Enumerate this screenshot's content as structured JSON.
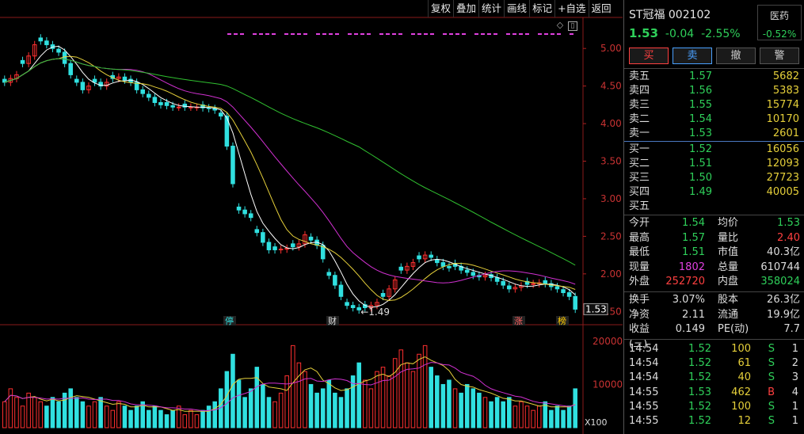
{
  "toolbar": [
    "复权",
    "叠加",
    "统计",
    "画线",
    "标记",
    "+自选",
    "返回"
  ],
  "chart": {
    "y_ticks": [
      "5.00",
      "4.50",
      "4.00",
      "3.50",
      "3.00",
      "2.50",
      "2.00",
      "1.50"
    ],
    "current_price": "1.53",
    "low_label": "1.49",
    "markers": [
      "停",
      "财",
      "涨",
      "榜"
    ],
    "vol_ticks": [
      "20000",
      "10000"
    ],
    "vol_unit": "X100"
  },
  "chart_data": {
    "type": "candlestick",
    "ylim": [
      1.45,
      5.35
    ],
    "closes": [
      4.55,
      4.6,
      4.65,
      4.8,
      4.9,
      5.05,
      5.1,
      5.05,
      5.0,
      4.95,
      4.8,
      4.65,
      4.55,
      4.45,
      4.5,
      4.55,
      4.5,
      4.55,
      4.6,
      4.62,
      4.58,
      4.55,
      4.45,
      4.4,
      4.35,
      4.28,
      4.25,
      4.24,
      4.22,
      4.22,
      4.22,
      4.22,
      4.22,
      4.21,
      4.2,
      4.18,
      4.1,
      3.7,
      3.2,
      2.85,
      2.8,
      2.75,
      2.55,
      2.42,
      2.32,
      2.32,
      2.33,
      2.34,
      2.36,
      2.4,
      2.52,
      2.45,
      2.38,
      2.2,
      1.98,
      1.85,
      1.7,
      1.58,
      1.55,
      1.52,
      1.55,
      1.58,
      1.62,
      1.7,
      1.8,
      1.92,
      2.05,
      2.1,
      2.15,
      2.2,
      2.25,
      2.22,
      2.15,
      2.1,
      2.08,
      2.1,
      2.05,
      2.02,
      1.98,
      1.96,
      1.98,
      1.95,
      1.9,
      1.85,
      1.8,
      1.82,
      1.84,
      1.86,
      1.87,
      1.88,
      1.87,
      1.83,
      1.8,
      1.75,
      1.7,
      1.53
    ],
    "volumes": [
      6000,
      9000,
      7000,
      5000,
      8000,
      7000,
      6000,
      5000,
      7000,
      6000,
      8000,
      9000,
      7000,
      6000,
      5000,
      6000,
      7000,
      5000,
      4000,
      6000,
      5000,
      4000,
      5000,
      6000,
      4000,
      5000,
      4000,
      3000,
      4000,
      5000,
      3000,
      4000,
      3000,
      4000,
      5000,
      6000,
      9000,
      13000,
      17000,
      11000,
      7000,
      9000,
      14000,
      10000,
      7000,
      6000,
      8000,
      12000,
      19000,
      15000,
      13000,
      10000,
      8000,
      9000,
      11000,
      8000,
      7000,
      9000,
      12000,
      15000,
      11000,
      9000,
      13000,
      14000,
      12000,
      16000,
      18000,
      15000,
      13000,
      17000,
      19000,
      14000,
      12000,
      10000,
      11000,
      9000,
      8000,
      10000,
      9000,
      8000,
      7000,
      6000,
      7000,
      6000,
      7000,
      5000,
      6000,
      5000,
      4000,
      5000,
      6000,
      4000,
      5000,
      4000,
      5000,
      9000
    ]
  },
  "quote": {
    "name": "ST冠福 002102",
    "price": "1.53",
    "change": "-0.04",
    "pct": "-2.55%",
    "industry": "医药",
    "industry_pct": "-0.52%"
  },
  "buttons": [
    "买",
    "卖",
    "撤",
    "警"
  ],
  "asks": [
    {
      "l": "卖五",
      "p": "1.57",
      "v": "5682"
    },
    {
      "l": "卖四",
      "p": "1.56",
      "v": "5383"
    },
    {
      "l": "卖三",
      "p": "1.55",
      "v": "15774"
    },
    {
      "l": "卖二",
      "p": "1.54",
      "v": "10170"
    },
    {
      "l": "卖一",
      "p": "1.53",
      "v": "2601"
    }
  ],
  "bids": [
    {
      "l": "买一",
      "p": "1.52",
      "v": "16056"
    },
    {
      "l": "买二",
      "p": "1.51",
      "v": "12093"
    },
    {
      "l": "买三",
      "p": "1.50",
      "v": "27723"
    },
    {
      "l": "买四",
      "p": "1.49",
      "v": "40005"
    },
    {
      "l": "买五",
      "p": "",
      "v": ""
    }
  ],
  "stats": [
    {
      "k": "今开",
      "a": "1.54",
      "ac": "g",
      "k2": "均价",
      "b": "1.53",
      "bc": "g"
    },
    {
      "k": "最高",
      "a": "1.57",
      "ac": "g",
      "k2": "量比",
      "b": "2.40",
      "bc": "r"
    },
    {
      "k": "最低",
      "a": "1.51",
      "ac": "g",
      "k2": "市值",
      "b": "40.3亿",
      "bc": "w"
    },
    {
      "k": "现量",
      "a": "1802",
      "ac": "m",
      "k2": "总量",
      "b": "610744",
      "bc": "w"
    },
    {
      "k": "外盘",
      "a": "252720",
      "ac": "r",
      "k2": "内盘",
      "b": "358024",
      "bc": "g"
    }
  ],
  "stats2": [
    {
      "k": "换手",
      "a": "3.07%",
      "ac": "w",
      "k2": "股本",
      "b": "26.3亿",
      "bc": "w"
    },
    {
      "k": "净资",
      "a": "2.11",
      "ac": "w",
      "k2": "流通",
      "b": "19.9亿",
      "bc": "w"
    },
    {
      "k": "收益(三)",
      "a": "0.149",
      "ac": "w",
      "k2": "PE(动)",
      "b": "7.7",
      "bc": "w"
    }
  ],
  "ticks": [
    {
      "t": "14:54",
      "p": "1.52",
      "v": "100",
      "s": "S",
      "n": "1"
    },
    {
      "t": "14:54",
      "p": "1.52",
      "v": "61",
      "s": "S",
      "n": "2"
    },
    {
      "t": "14:54",
      "p": "1.52",
      "v": "40",
      "s": "S",
      "n": "3"
    },
    {
      "t": "14:55",
      "p": "1.53",
      "v": "462",
      "s": "B",
      "n": "4"
    },
    {
      "t": "14:55",
      "p": "1.52",
      "v": "100",
      "s": "S",
      "n": "1"
    },
    {
      "t": "14:55",
      "p": "1.52",
      "v": "12",
      "s": "S",
      "n": "1"
    }
  ]
}
